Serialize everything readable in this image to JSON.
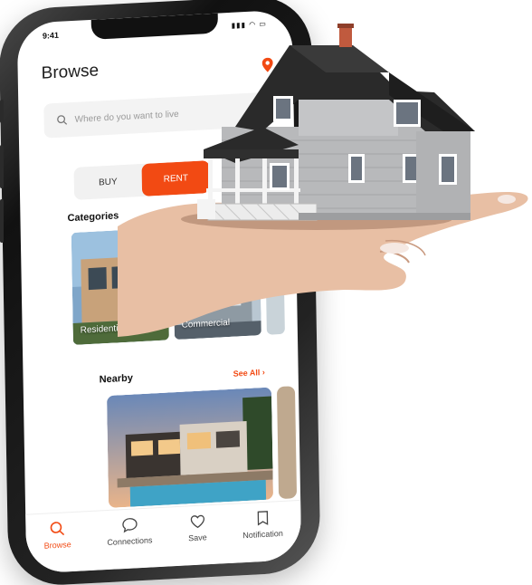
{
  "status": {
    "time": "9:41",
    "icons": "▮▮▮ ◠ ▭"
  },
  "header": {
    "title": "Browse"
  },
  "search": {
    "placeholder": "Where do you want to live"
  },
  "toggle": {
    "buy_label": "BUY",
    "rent_label": "RENT",
    "active": "rent"
  },
  "categories": {
    "label": "Categories",
    "items": [
      {
        "label": "Residential"
      },
      {
        "label": "Commercial"
      }
    ]
  },
  "nearby": {
    "label": "Nearby",
    "see_all": "See All ›"
  },
  "bottom_nav": {
    "items": [
      {
        "label": "Browse",
        "icon": "search-icon",
        "active": true
      },
      {
        "label": "Connections",
        "icon": "chat-icon",
        "active": false
      },
      {
        "label": "Save",
        "icon": "heart-icon",
        "active": false
      },
      {
        "label": "Notification",
        "icon": "bell-icon",
        "active": false
      }
    ]
  },
  "colors": {
    "accent": "#f24a13",
    "text": "#1d1d1d",
    "muted": "#9a9a9a"
  }
}
